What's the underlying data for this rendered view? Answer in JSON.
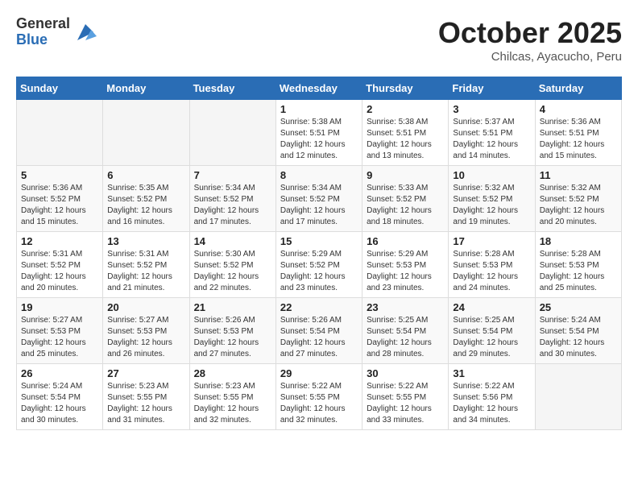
{
  "logo": {
    "general": "General",
    "blue": "Blue"
  },
  "header": {
    "month": "October 2025",
    "location": "Chilcas, Ayacucho, Peru"
  },
  "weekdays": [
    "Sunday",
    "Monday",
    "Tuesday",
    "Wednesday",
    "Thursday",
    "Friday",
    "Saturday"
  ],
  "weeks": [
    [
      {
        "day": "",
        "info": ""
      },
      {
        "day": "",
        "info": ""
      },
      {
        "day": "",
        "info": ""
      },
      {
        "day": "1",
        "info": "Sunrise: 5:38 AM\nSunset: 5:51 PM\nDaylight: 12 hours\nand 12 minutes."
      },
      {
        "day": "2",
        "info": "Sunrise: 5:38 AM\nSunset: 5:51 PM\nDaylight: 12 hours\nand 13 minutes."
      },
      {
        "day": "3",
        "info": "Sunrise: 5:37 AM\nSunset: 5:51 PM\nDaylight: 12 hours\nand 14 minutes."
      },
      {
        "day": "4",
        "info": "Sunrise: 5:36 AM\nSunset: 5:51 PM\nDaylight: 12 hours\nand 15 minutes."
      }
    ],
    [
      {
        "day": "5",
        "info": "Sunrise: 5:36 AM\nSunset: 5:52 PM\nDaylight: 12 hours\nand 15 minutes."
      },
      {
        "day": "6",
        "info": "Sunrise: 5:35 AM\nSunset: 5:52 PM\nDaylight: 12 hours\nand 16 minutes."
      },
      {
        "day": "7",
        "info": "Sunrise: 5:34 AM\nSunset: 5:52 PM\nDaylight: 12 hours\nand 17 minutes."
      },
      {
        "day": "8",
        "info": "Sunrise: 5:34 AM\nSunset: 5:52 PM\nDaylight: 12 hours\nand 17 minutes."
      },
      {
        "day": "9",
        "info": "Sunrise: 5:33 AM\nSunset: 5:52 PM\nDaylight: 12 hours\nand 18 minutes."
      },
      {
        "day": "10",
        "info": "Sunrise: 5:32 AM\nSunset: 5:52 PM\nDaylight: 12 hours\nand 19 minutes."
      },
      {
        "day": "11",
        "info": "Sunrise: 5:32 AM\nSunset: 5:52 PM\nDaylight: 12 hours\nand 20 minutes."
      }
    ],
    [
      {
        "day": "12",
        "info": "Sunrise: 5:31 AM\nSunset: 5:52 PM\nDaylight: 12 hours\nand 20 minutes."
      },
      {
        "day": "13",
        "info": "Sunrise: 5:31 AM\nSunset: 5:52 PM\nDaylight: 12 hours\nand 21 minutes."
      },
      {
        "day": "14",
        "info": "Sunrise: 5:30 AM\nSunset: 5:52 PM\nDaylight: 12 hours\nand 22 minutes."
      },
      {
        "day": "15",
        "info": "Sunrise: 5:29 AM\nSunset: 5:52 PM\nDaylight: 12 hours\nand 23 minutes."
      },
      {
        "day": "16",
        "info": "Sunrise: 5:29 AM\nSunset: 5:53 PM\nDaylight: 12 hours\nand 23 minutes."
      },
      {
        "day": "17",
        "info": "Sunrise: 5:28 AM\nSunset: 5:53 PM\nDaylight: 12 hours\nand 24 minutes."
      },
      {
        "day": "18",
        "info": "Sunrise: 5:28 AM\nSunset: 5:53 PM\nDaylight: 12 hours\nand 25 minutes."
      }
    ],
    [
      {
        "day": "19",
        "info": "Sunrise: 5:27 AM\nSunset: 5:53 PM\nDaylight: 12 hours\nand 25 minutes."
      },
      {
        "day": "20",
        "info": "Sunrise: 5:27 AM\nSunset: 5:53 PM\nDaylight: 12 hours\nand 26 minutes."
      },
      {
        "day": "21",
        "info": "Sunrise: 5:26 AM\nSunset: 5:53 PM\nDaylight: 12 hours\nand 27 minutes."
      },
      {
        "day": "22",
        "info": "Sunrise: 5:26 AM\nSunset: 5:54 PM\nDaylight: 12 hours\nand 27 minutes."
      },
      {
        "day": "23",
        "info": "Sunrise: 5:25 AM\nSunset: 5:54 PM\nDaylight: 12 hours\nand 28 minutes."
      },
      {
        "day": "24",
        "info": "Sunrise: 5:25 AM\nSunset: 5:54 PM\nDaylight: 12 hours\nand 29 minutes."
      },
      {
        "day": "25",
        "info": "Sunrise: 5:24 AM\nSunset: 5:54 PM\nDaylight: 12 hours\nand 30 minutes."
      }
    ],
    [
      {
        "day": "26",
        "info": "Sunrise: 5:24 AM\nSunset: 5:54 PM\nDaylight: 12 hours\nand 30 minutes."
      },
      {
        "day": "27",
        "info": "Sunrise: 5:23 AM\nSunset: 5:55 PM\nDaylight: 12 hours\nand 31 minutes."
      },
      {
        "day": "28",
        "info": "Sunrise: 5:23 AM\nSunset: 5:55 PM\nDaylight: 12 hours\nand 32 minutes."
      },
      {
        "day": "29",
        "info": "Sunrise: 5:22 AM\nSunset: 5:55 PM\nDaylight: 12 hours\nand 32 minutes."
      },
      {
        "day": "30",
        "info": "Sunrise: 5:22 AM\nSunset: 5:55 PM\nDaylight: 12 hours\nand 33 minutes."
      },
      {
        "day": "31",
        "info": "Sunrise: 5:22 AM\nSunset: 5:56 PM\nDaylight: 12 hours\nand 34 minutes."
      },
      {
        "day": "",
        "info": ""
      }
    ]
  ]
}
